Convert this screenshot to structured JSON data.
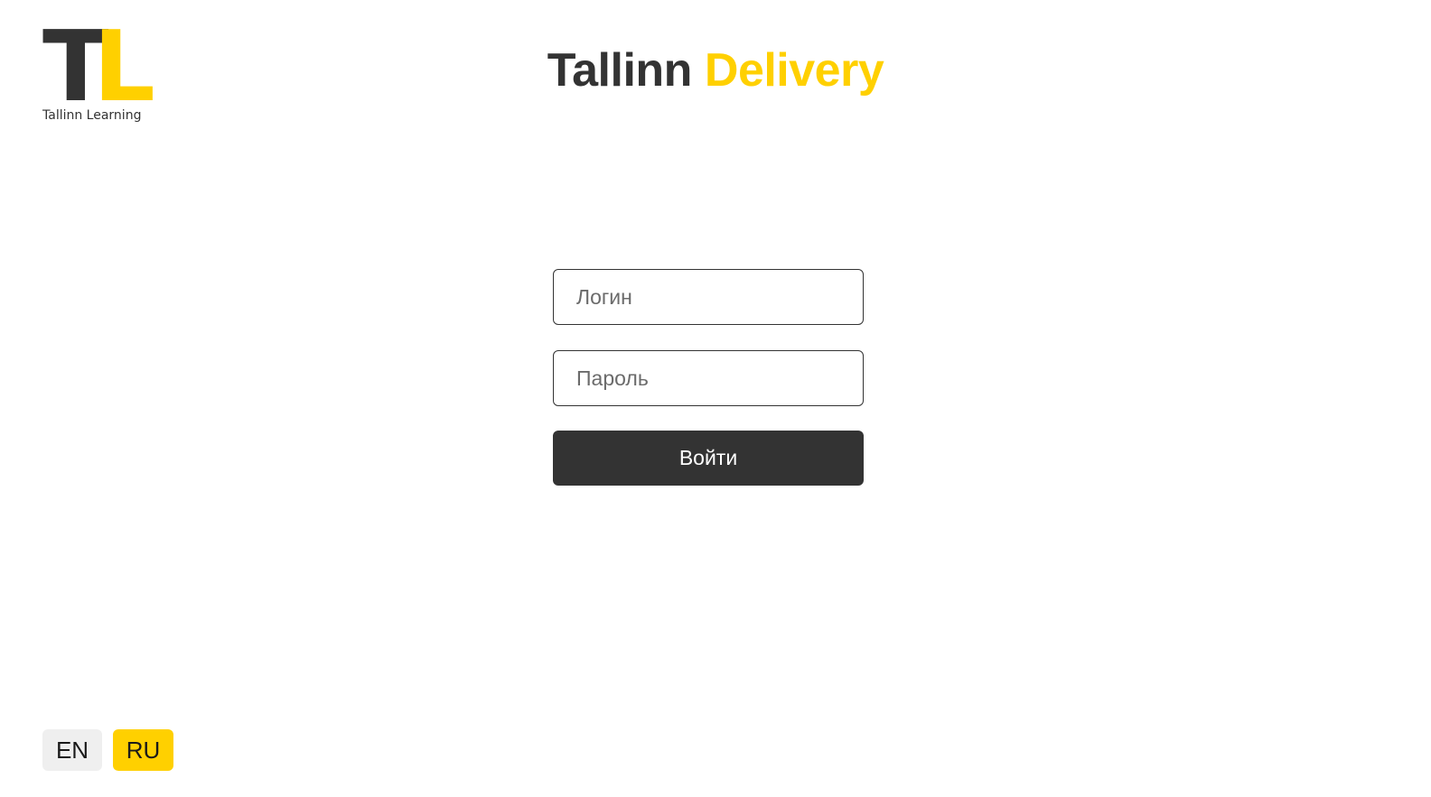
{
  "brand": {
    "logo_letter_1": "T",
    "logo_letter_2": "L",
    "logo_caption": "Tallinn Learning",
    "accent_color": "#ffd000",
    "dark_color": "#333333"
  },
  "header": {
    "title_part1": "Tallinn",
    "title_part2": "Delivery"
  },
  "login_form": {
    "login_placeholder": "Логин",
    "login_value": "",
    "password_placeholder": "Пароль",
    "password_value": "",
    "submit_label": "Войти"
  },
  "language_switcher": {
    "options": [
      {
        "label": "EN",
        "active": false
      },
      {
        "label": "RU",
        "active": true
      }
    ]
  }
}
